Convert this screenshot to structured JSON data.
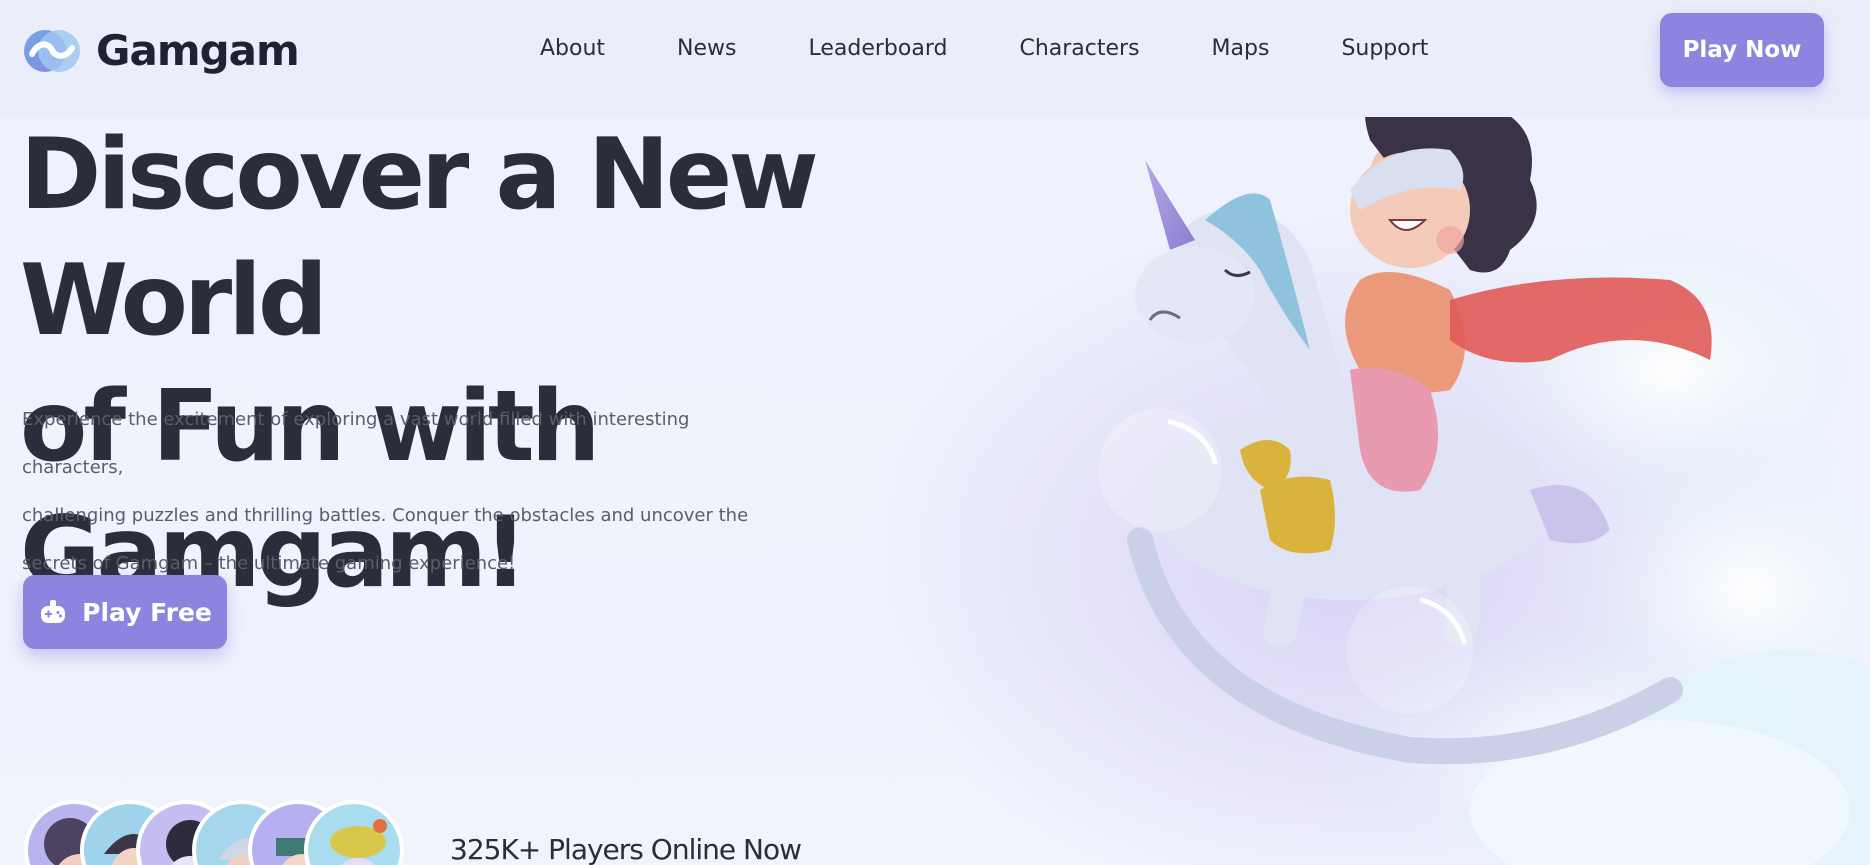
{
  "brand": {
    "name": "Gamgam",
    "accent": "#8b85e0"
  },
  "nav": {
    "items": [
      {
        "label": "About"
      },
      {
        "label": "News"
      },
      {
        "label": "Leaderboard"
      },
      {
        "label": "Characters"
      },
      {
        "label": "Maps"
      },
      {
        "label": "Support"
      }
    ],
    "cta": "Play Now"
  },
  "hero": {
    "title_line1": "Discover a New World",
    "title_line2": "of Fun with Gamgam!",
    "desc_line1": "Experience the excitement of exploring a vast world filled with interesting characters,",
    "desc_line2": "challenging puzzles and thrilling battles. Conquer the obstacles and uncover the",
    "desc_line3": "secrets of Gamgam – the ultimate gaming experience!",
    "cta": "Play Free",
    "cta_icon": "gamepad-icon"
  },
  "players": {
    "text": "325K+ Players Online Now",
    "avatar_count": 6
  }
}
